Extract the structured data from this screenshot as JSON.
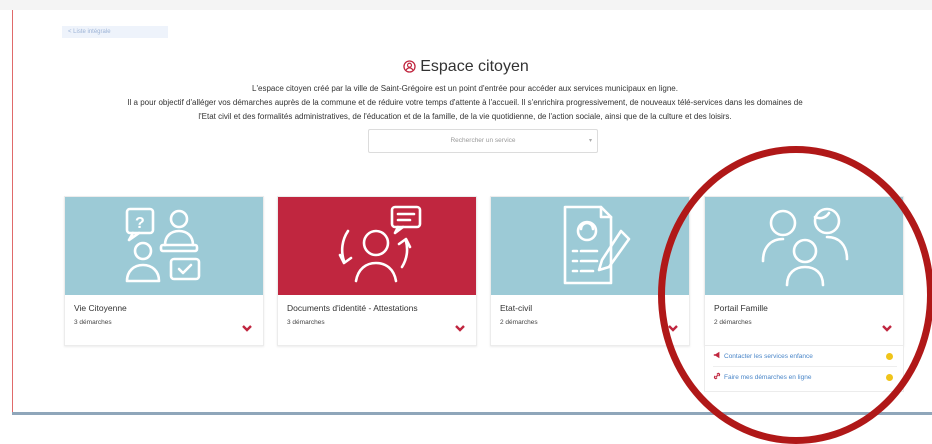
{
  "nav": {
    "back_label": "< Liste intégrale"
  },
  "header": {
    "title": "Espace citoyen",
    "intro_line1": "L'espace citoyen créé par la ville de Saint-Grégoire est un point d'entrée pour accéder aux services municipaux en ligne.",
    "intro_line2": "Il a pour objectif d'alléger vos démarches auprès de la commune et de réduire votre temps d'attente à l'accueil. Il s'enrichira progressivement, de nouveaux télé-services dans les domaines de",
    "intro_line3": "l'Etat civil et des formalités administratives, de l'éducation et de la famille, de la vie quotidienne, de l'action sociale, ainsi que de la culture et des loisirs."
  },
  "search": {
    "placeholder": "Rechercher un service"
  },
  "cards": [
    {
      "title": "Vie Citoyenne",
      "count": "3 démarches",
      "icon": "citizens-dialogue-icon"
    },
    {
      "title": "Documents d'identité - Attestations",
      "count": "3 démarches",
      "icon": "person-documents-icon"
    },
    {
      "title": "Etat-civil",
      "count": "2 démarches",
      "icon": "document-pen-icon"
    },
    {
      "title": "Portail Famille",
      "count": "2 démarches",
      "icon": "family-icon"
    }
  ],
  "family_links": [
    {
      "label": "Contacter les services enfance",
      "icon": "megaphone-icon"
    },
    {
      "label": "Faire mes démarches en ligne",
      "icon": "link-icon"
    }
  ],
  "colors": {
    "accent": "#c0263f",
    "card_art": "#9ccad6",
    "link": "#4a86c8",
    "status_dot": "#f0c419",
    "annotation": "#b01818"
  }
}
